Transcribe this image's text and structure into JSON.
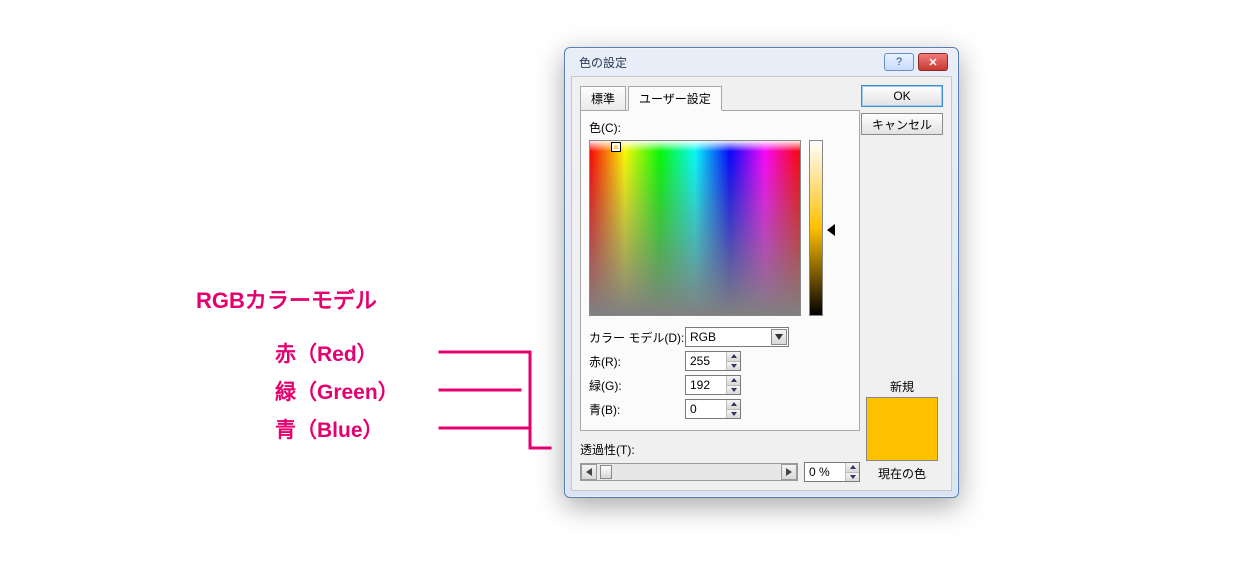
{
  "annotation": {
    "title": "RGBカラーモデル",
    "r": "赤（Red）",
    "g": "緑（Green）",
    "b": "青（Blue）"
  },
  "dialog": {
    "title": "色の設定",
    "help_glyph": "?",
    "close_glyph": "✕",
    "ok": "OK",
    "cancel": "キャンセル",
    "tabs": {
      "standard": "標準",
      "custom": "ユーザー設定"
    },
    "color_label": "色(C):",
    "model_label": "カラー モデル(D):",
    "model_value": "RGB",
    "r_label": "赤(R):",
    "g_label": "緑(G):",
    "b_label": "青(B):",
    "r_value": "255",
    "g_value": "192",
    "b_value": "0",
    "trans_label": "透過性(T):",
    "trans_value": "0 %",
    "new_label": "新規",
    "current_label": "現在の色",
    "swatch_color": "#ffc000"
  }
}
